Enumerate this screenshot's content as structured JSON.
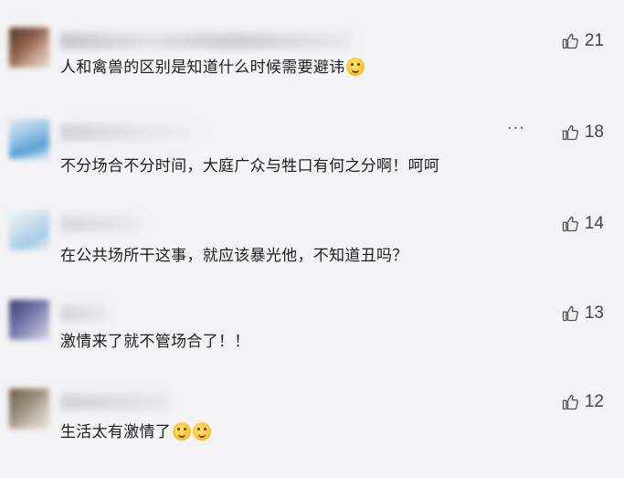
{
  "comments": [
    {
      "text": "人和禽兽的区别是知道什么时候需要避讳",
      "emoji": "emoji-sweat-smile",
      "likes": "21",
      "avatar_color": "#7a4f3c",
      "has_more": false
    },
    {
      "text": "不分场合不分时间，大庭广众与牲口有何之分啊！呵呵",
      "likes": "18",
      "avatar_color": "#9cc8e6",
      "has_more": true,
      "more_label": "···"
    },
    {
      "text": "在公共场所干这事，就应该暴光他，不知道丑吗？",
      "likes": "14",
      "avatar_color": "#bfd6e8",
      "has_more": false
    },
    {
      "text": "激情来了就不管场合了！！",
      "likes": "13",
      "avatar_color": "#6f6f9e",
      "has_more": false
    },
    {
      "text": "生活太有激情了",
      "emoji": "emoji-thinking",
      "likes": "12",
      "avatar_color": "#8a7a6a",
      "has_more": false
    }
  ]
}
